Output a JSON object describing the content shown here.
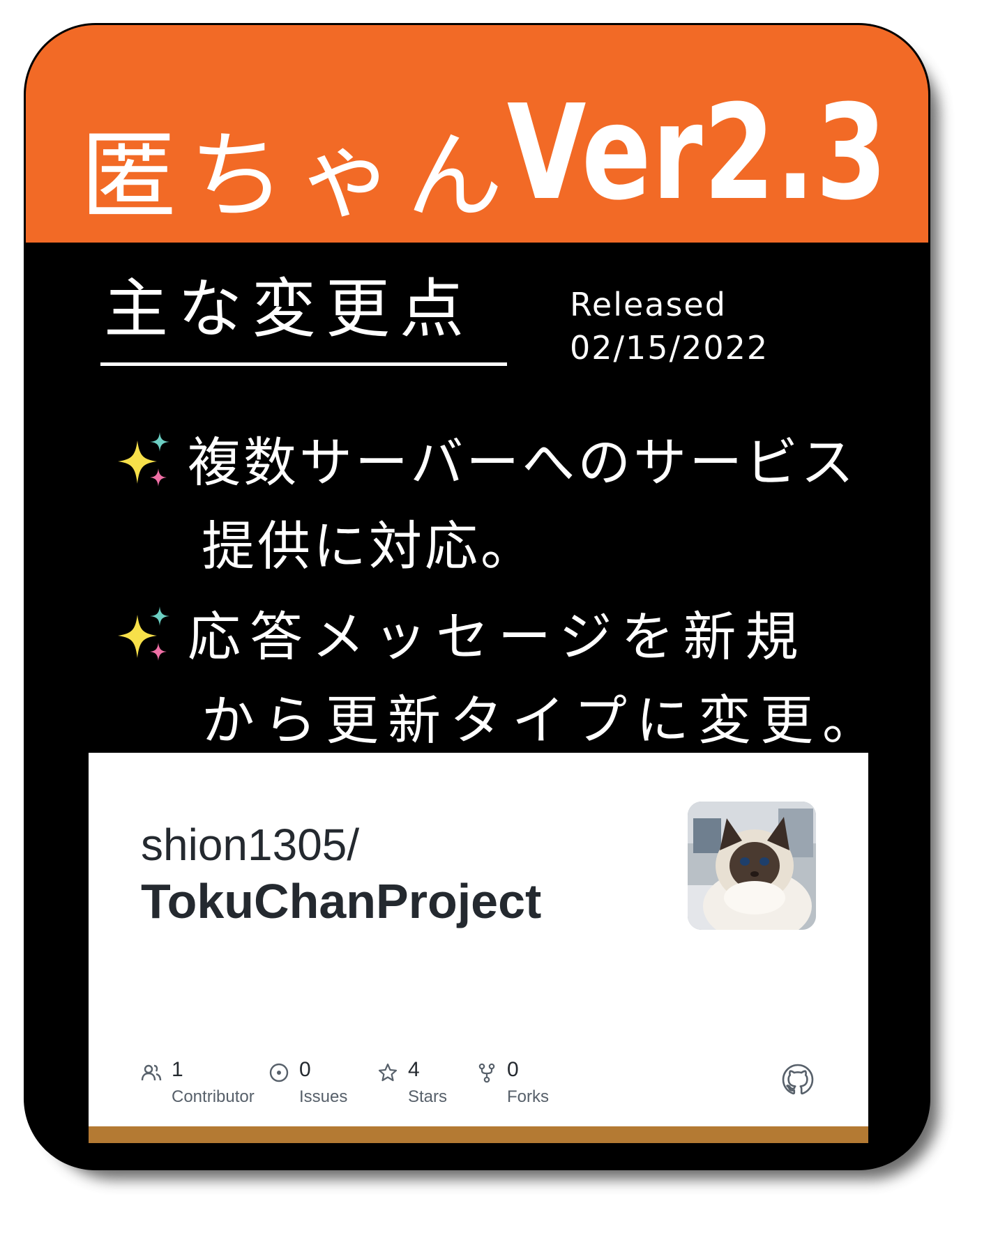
{
  "header": {
    "title": "匿ちゃん",
    "version": "Ver2.3",
    "background_color": "#f26a26"
  },
  "changes": {
    "section_title": "主な変更点",
    "released_label": "Released",
    "released_date": "02/15/2022",
    "items": [
      {
        "icon": "sparkles-icon",
        "line1": "複数サーバーへのサービス",
        "line2": "提供に対応。"
      },
      {
        "icon": "sparkles-icon",
        "line1": "応答メッセージを新規",
        "line2": "から更新タイプに変更。"
      }
    ]
  },
  "repo": {
    "owner": "shion1305/",
    "name": "TokuChanProject",
    "avatar": "cat-avatar",
    "stats": [
      {
        "icon": "people-icon",
        "value": "1",
        "label": "Contributor"
      },
      {
        "icon": "issue-icon",
        "value": "0",
        "label": "Issues"
      },
      {
        "icon": "star-icon",
        "value": "4",
        "label": "Stars"
      },
      {
        "icon": "fork-icon",
        "value": "0",
        "label": "Forks"
      }
    ],
    "github_icon": "github-icon",
    "accent_color": "#b47a33"
  }
}
